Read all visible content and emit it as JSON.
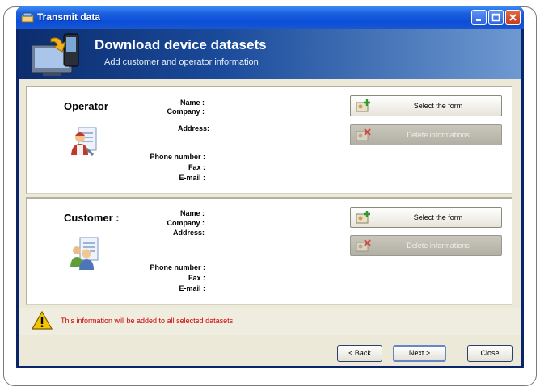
{
  "window": {
    "title": "Transmit data"
  },
  "header": {
    "title": "Download device datasets",
    "subtitle": "Add customer and operator information"
  },
  "labels": {
    "name": "Name :",
    "company": "Company :",
    "address": "Address:",
    "phone": "Phone number :",
    "fax": "Fax :",
    "email": "E-mail :"
  },
  "operator": {
    "title": "Operator",
    "select_label": "Select the form",
    "delete_label": "Delete informations"
  },
  "customer": {
    "title": "Customer :",
    "select_label": "Select the form",
    "delete_label": "Delete informations"
  },
  "warning": {
    "text": "This information will be added to all selected datasets."
  },
  "footer": {
    "back_label": "< Back",
    "next_label": "Next >",
    "close_label": "Close"
  },
  "colors": {
    "title_bar": "#0a4ed8",
    "header_bg": "#1a4a9a",
    "warning_text": "#cc0000",
    "client_bg": "#ece9d8"
  }
}
